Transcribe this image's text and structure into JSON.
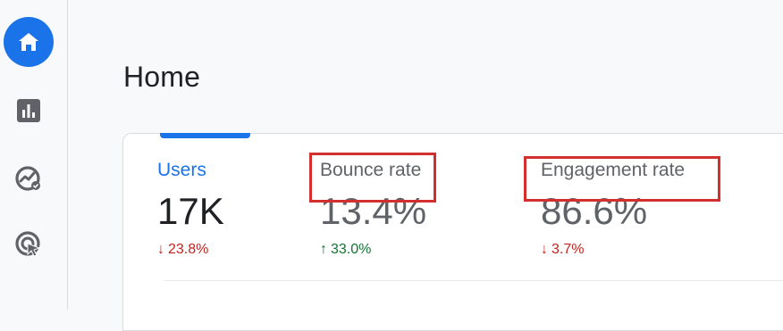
{
  "nav": {
    "items": [
      {
        "icon": "home-icon",
        "active": true
      },
      {
        "icon": "reports-icon",
        "active": false
      },
      {
        "icon": "explore-icon",
        "active": false
      },
      {
        "icon": "advertising-icon",
        "active": false
      }
    ]
  },
  "page": {
    "title": "Home"
  },
  "metrics": [
    {
      "label": "Users",
      "value": "17K",
      "change": "23.8%",
      "direction": "down",
      "arrow": "🠗"
    },
    {
      "label": "Bounce rate",
      "value": "13.4%",
      "change": "33.0%",
      "direction": "up",
      "arrow": "🠕"
    },
    {
      "label": "Engagement rate",
      "value": "86.6%",
      "change": "3.7%",
      "direction": "down",
      "arrow": "🠗"
    }
  ],
  "colors": {
    "accent": "#1a73e8",
    "positive": "#137333",
    "negative": "#c5221f",
    "highlight": "#d32f2f"
  }
}
